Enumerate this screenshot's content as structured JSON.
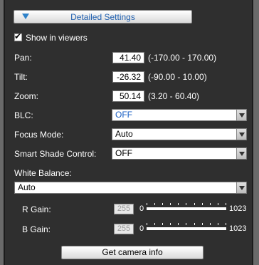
{
  "section_button": {
    "label": "Detailed Settings",
    "icon": "triangle-down-icon"
  },
  "show_in_viewers": {
    "label": "Show in viewers",
    "checked": true
  },
  "pan": {
    "label": "Pan:",
    "value": "41.40",
    "range": "(-170.00 - 170.00)"
  },
  "tilt": {
    "label": "Tilt:",
    "value": "-26.32",
    "range": "(-90.00 - 10.00)"
  },
  "zoom": {
    "label": "Zoom:",
    "value": "50.14",
    "range": "(3.20 - 60.40)"
  },
  "blc": {
    "label": "BLC:",
    "value": "OFF"
  },
  "focus_mode": {
    "label": "Focus Mode:",
    "value": "Auto"
  },
  "smart_shade": {
    "label": "Smart Shade Control:",
    "value": "OFF"
  },
  "white_balance": {
    "label": "White Balance:",
    "value": "Auto"
  },
  "r_gain": {
    "label": "R Gain:",
    "value": "255",
    "min": "0",
    "max": "1023"
  },
  "b_gain": {
    "label": "B Gain:",
    "value": "255",
    "min": "0",
    "max": "1023"
  },
  "get_info_button": {
    "label": "Get camera info"
  },
  "colors": {
    "background": "#2f2f2f",
    "accent_blue": "#1a5fc4",
    "section_label": "#2060b0"
  }
}
